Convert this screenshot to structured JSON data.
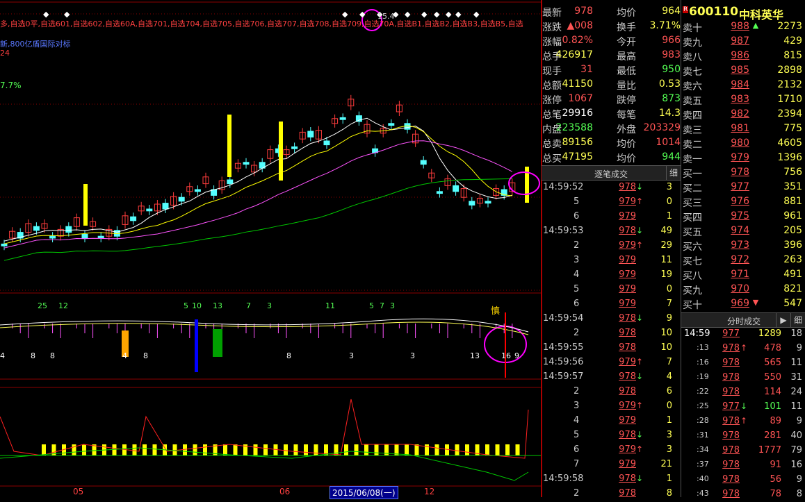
{
  "chart": {
    "ma_legend_top": "多,自选0平,自选601,自选602,自选60A,自选701,自选704,自选705,自选706,自选707,自选708,自选709,自选70A,自选B1,自选B2,自选B3,自选B5,自选",
    "ma_legend_2": "新,800亿盾国际对标",
    "ma_legend_3": "24",
    "ma_legend_4": "7.7%",
    "top_label": "15.4",
    "lower1_numbers": [
      "25",
      "12",
      "5",
      "10",
      "13",
      "7",
      "3",
      "11",
      "5",
      "7",
      "3"
    ],
    "lower1_bottom_numbers": [
      "4",
      "8",
      "8",
      "4",
      "8",
      "8",
      "3",
      "3",
      "13",
      "16",
      "9"
    ],
    "lower1_flag": "慎",
    "x_labels": [
      "05",
      "06",
      "12"
    ],
    "date_cursor": "2015/06/08(一)",
    "colors": {
      "up": "#ff3c3c",
      "down": "#54ffff",
      "ma5": "#ffffff",
      "ma10": "#ffff00",
      "ma20": "#ff54ff",
      "ma60": "#00c800",
      "grid": "#8b0000",
      "highlight": "#ff00ff"
    }
  },
  "header": {
    "badge": "R",
    "code": "600110",
    "name": "中科英华"
  },
  "quote": [
    {
      "l1": "最新",
      "v1": "978",
      "c1": "red",
      "l2": "均价",
      "v2": "964",
      "c2": "yellow"
    },
    {
      "l1": "涨跌",
      "v1": "▲008",
      "c1": "red",
      "l2": "换手",
      "v2": "3.71%",
      "c2": "yellow"
    },
    {
      "l1": "涨幅",
      "v1": "0.82%",
      "c1": "red",
      "l2": "今开",
      "v2": "966",
      "c2": "red"
    },
    {
      "l1": "总手",
      "v1": "426917",
      "c1": "yellow",
      "l2": "最高",
      "v2": "983",
      "c2": "red"
    },
    {
      "l1": "现手",
      "v1": "31",
      "c1": "red",
      "l2": "最低",
      "v2": "950",
      "c2": "green"
    },
    {
      "l1": "总额",
      "v1": "41150",
      "c1": "yellow",
      "l2": "量比",
      "v2": "0.53",
      "c2": "yellow"
    },
    {
      "l1": "涨停",
      "v1": "1067",
      "c1": "red",
      "l2": "跌停",
      "v2": "873",
      "c2": "green"
    },
    {
      "l1": "总笔",
      "v1": "29916",
      "c1": "white",
      "l2": "每笔",
      "v2": "14.3",
      "c2": "yellow"
    },
    {
      "l1": "内盘",
      "v1": "223588",
      "c1": "green",
      "l2": "外盘",
      "v2": "203329",
      "c2": "red"
    },
    {
      "l1": "总卖",
      "v1": "89156",
      "c1": "yellow",
      "l2": "均价",
      "v2": "1014",
      "c2": "red"
    },
    {
      "l1": "总买",
      "v1": "47195",
      "c1": "yellow",
      "l2": "均价",
      "v2": "944",
      "c2": "green"
    }
  ],
  "orderbook": [
    {
      "label": "卖十",
      "price": "988",
      "flag": "▲",
      "fc": "green",
      "vol": "2273"
    },
    {
      "label": "卖九",
      "price": "987",
      "flag": "",
      "fc": "",
      "vol": "429"
    },
    {
      "label": "卖八",
      "price": "986",
      "flag": "",
      "fc": "",
      "vol": "815"
    },
    {
      "label": "卖七",
      "price": "985",
      "flag": "",
      "fc": "",
      "vol": "2898"
    },
    {
      "label": "卖六",
      "price": "984",
      "flag": "",
      "fc": "",
      "vol": "2132"
    },
    {
      "label": "卖五",
      "price": "983",
      "flag": "",
      "fc": "",
      "vol": "1710"
    },
    {
      "label": "卖四",
      "price": "982",
      "flag": "",
      "fc": "",
      "vol": "2394"
    },
    {
      "label": "卖三",
      "price": "981",
      "flag": "",
      "fc": "",
      "vol": "775"
    },
    {
      "label": "卖二",
      "price": "980",
      "flag": "",
      "fc": "",
      "vol": "4605"
    },
    {
      "label": "卖一",
      "price": "979",
      "flag": "",
      "fc": "",
      "vol": "1396"
    },
    {
      "label": "买一",
      "price": "978",
      "flag": "",
      "fc": "",
      "vol": "756"
    },
    {
      "label": "买二",
      "price": "977",
      "flag": "",
      "fc": "",
      "vol": "351"
    },
    {
      "label": "买三",
      "price": "976",
      "flag": "",
      "fc": "",
      "vol": "881"
    },
    {
      "label": "买四",
      "price": "975",
      "flag": "",
      "fc": "",
      "vol": "961"
    },
    {
      "label": "买五",
      "price": "974",
      "flag": "",
      "fc": "",
      "vol": "205"
    },
    {
      "label": "买六",
      "price": "973",
      "flag": "",
      "fc": "",
      "vol": "396"
    },
    {
      "label": "买七",
      "price": "972",
      "flag": "",
      "fc": "",
      "vol": "263"
    },
    {
      "label": "买八",
      "price": "971",
      "flag": "",
      "fc": "",
      "vol": "491"
    },
    {
      "label": "买九",
      "price": "970",
      "flag": "",
      "fc": "",
      "vol": "821"
    },
    {
      "label": "买十",
      "price": "969",
      "flag": "▼",
      "fc": "red",
      "vol": "547"
    }
  ],
  "ticks_header": {
    "title": "逐笔成交",
    "btn": "细"
  },
  "ticks": [
    {
      "time": "14:59:52",
      "price": "978",
      "pc": "red",
      "arrow": "↓",
      "ac": "green",
      "vol": "3"
    },
    {
      "time": "5",
      "price": "979",
      "pc": "red",
      "arrow": "↑",
      "ac": "red",
      "vol": "0"
    },
    {
      "time": "6",
      "price": "979",
      "pc": "red",
      "arrow": "",
      "ac": "",
      "vol": "1"
    },
    {
      "time": "14:59:53",
      "price": "978",
      "pc": "red",
      "arrow": "↓",
      "ac": "green",
      "vol": "49"
    },
    {
      "time": "2",
      "price": "979",
      "pc": "red",
      "arrow": "↑",
      "ac": "red",
      "vol": "29"
    },
    {
      "time": "3",
      "price": "979",
      "pc": "red",
      "arrow": "",
      "ac": "",
      "vol": "11"
    },
    {
      "time": "4",
      "price": "979",
      "pc": "red",
      "arrow": "",
      "ac": "",
      "vol": "19"
    },
    {
      "time": "5",
      "price": "979",
      "pc": "red",
      "arrow": "",
      "ac": "",
      "vol": "0"
    },
    {
      "time": "6",
      "price": "979",
      "pc": "red",
      "arrow": "",
      "ac": "",
      "vol": "7"
    },
    {
      "time": "14:59:54",
      "price": "978",
      "pc": "red",
      "arrow": "↓",
      "ac": "green",
      "vol": "9"
    },
    {
      "time": "2",
      "price": "978",
      "pc": "red",
      "arrow": "",
      "ac": "",
      "vol": "10"
    },
    {
      "time": "14:59:55",
      "price": "978",
      "pc": "red",
      "arrow": "",
      "ac": "",
      "vol": "10"
    },
    {
      "time": "14:59:56",
      "price": "979",
      "pc": "red",
      "arrow": "↑",
      "ac": "red",
      "vol": "7"
    },
    {
      "time": "14:59:57",
      "price": "978",
      "pc": "red",
      "arrow": "↓",
      "ac": "green",
      "vol": "4"
    },
    {
      "time": "2",
      "price": "978",
      "pc": "red",
      "arrow": "",
      "ac": "",
      "vol": "6"
    },
    {
      "time": "3",
      "price": "979",
      "pc": "red",
      "arrow": "↑",
      "ac": "red",
      "vol": "0"
    },
    {
      "time": "4",
      "price": "979",
      "pc": "red",
      "arrow": "",
      "ac": "",
      "vol": "1"
    },
    {
      "time": "5",
      "price": "978",
      "pc": "red",
      "arrow": "↓",
      "ac": "green",
      "vol": "3"
    },
    {
      "time": "6",
      "price": "979",
      "pc": "red",
      "arrow": "↑",
      "ac": "red",
      "vol": "3"
    },
    {
      "time": "7",
      "price": "979",
      "pc": "red",
      "arrow": "",
      "ac": "",
      "vol": "21"
    },
    {
      "time": "14:59:58",
      "price": "978",
      "pc": "red",
      "arrow": "↓",
      "ac": "green",
      "vol": "1"
    },
    {
      "time": "2",
      "price": "978",
      "pc": "red",
      "arrow": "",
      "ac": "",
      "vol": "8"
    }
  ],
  "fenshi_header": {
    "title": "分时成交",
    "play": "▶",
    "btn": "细"
  },
  "fenshi": [
    {
      "time": "14:59",
      "price": "977",
      "pc": "red",
      "arrow": "",
      "ac": "",
      "vol": "1289",
      "vc": "yellow",
      "cnt": "18"
    },
    {
      "time": ":13",
      "price": "978",
      "pc": "red",
      "arrow": "↑",
      "ac": "red",
      "vol": "478",
      "vc": "red",
      "cnt": "9"
    },
    {
      "time": ":16",
      "price": "978",
      "pc": "red",
      "arrow": "",
      "ac": "",
      "vol": "565",
      "vc": "red",
      "cnt": "11"
    },
    {
      "time": ":19",
      "price": "978",
      "pc": "red",
      "arrow": "",
      "ac": "",
      "vol": "550",
      "vc": "red",
      "cnt": "31"
    },
    {
      "time": ":22",
      "price": "978",
      "pc": "red",
      "arrow": "",
      "ac": "",
      "vol": "114",
      "vc": "red",
      "cnt": "24"
    },
    {
      "time": ":25",
      "price": "977",
      "pc": "red",
      "arrow": "↓",
      "ac": "green",
      "vol": "101",
      "vc": "green",
      "cnt": "11"
    },
    {
      "time": ":28",
      "price": "978",
      "pc": "red",
      "arrow": "↑",
      "ac": "red",
      "vol": "89",
      "vc": "red",
      "cnt": "9"
    },
    {
      "time": ":31",
      "price": "978",
      "pc": "red",
      "arrow": "",
      "ac": "",
      "vol": "281",
      "vc": "red",
      "cnt": "40"
    },
    {
      "time": ":34",
      "price": "978",
      "pc": "red",
      "arrow": "",
      "ac": "",
      "vol": "1777",
      "vc": "red",
      "cnt": "79"
    },
    {
      "time": ":37",
      "price": "978",
      "pc": "red",
      "arrow": "",
      "ac": "",
      "vol": "91",
      "vc": "red",
      "cnt": "16"
    },
    {
      "time": ":40",
      "price": "978",
      "pc": "red",
      "arrow": "",
      "ac": "",
      "vol": "56",
      "vc": "red",
      "cnt": "9"
    },
    {
      "time": ":43",
      "price": "978",
      "pc": "red",
      "arrow": "",
      "ac": "",
      "vol": "78",
      "vc": "red",
      "cnt": "8"
    }
  ]
}
